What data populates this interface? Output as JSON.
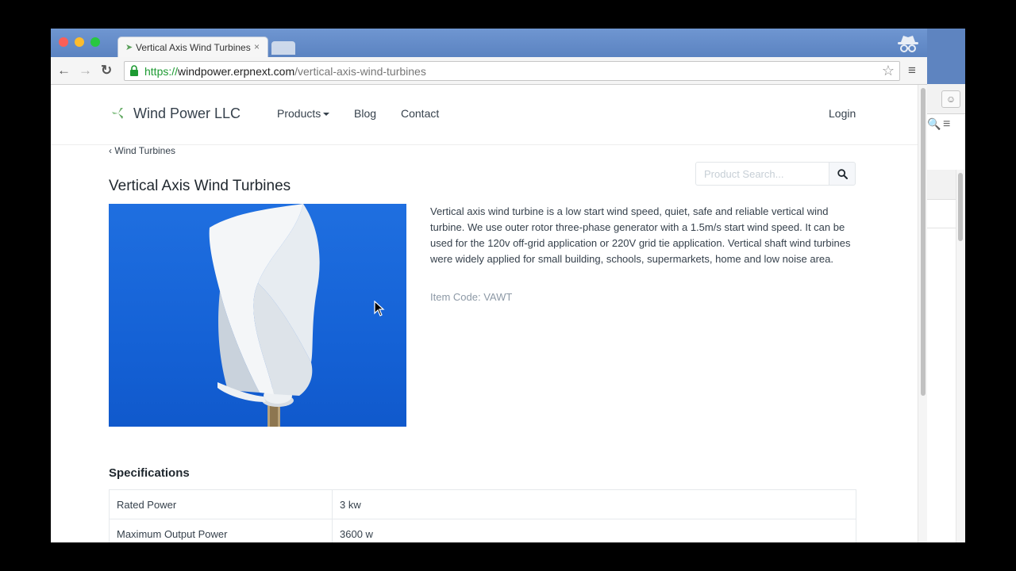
{
  "browser": {
    "tab_title": "Vertical Axis Wind Turbines",
    "tab_close": "×",
    "url_scheme": "https://",
    "url_host": "windpower.erpnext.com",
    "url_path": "/vertical-axis-wind-turbines",
    "back": "←",
    "forward": "→",
    "reload": "↻",
    "star": "☆",
    "menu": "≡",
    "colors": {
      "titlebar": "#5b83c1",
      "secure": "#1d9a32"
    }
  },
  "site": {
    "brand": "Wind Power LLC",
    "nav": {
      "products": "Products",
      "blog": "Blog",
      "contact": "Contact",
      "login": "Login"
    }
  },
  "breadcrumb": "‹ Wind Turbines",
  "search": {
    "placeholder": "Product Search..."
  },
  "product": {
    "title": "Vertical Axis Wind Turbines",
    "description": "Vertical axis wind turbine is a low start wind speed, quiet, safe and reliable vertical wind turbine. We use outer rotor three-phase generator with a 1.5m/s start wind speed. It can be used for the 120v off-grid application or 220V grid tie application. Vertical shaft wind turbines were widely applied for small building, schools, supermarkets, home and low noise area.",
    "item_code": "Item Code: VAWT"
  },
  "specifications": {
    "heading": "Specifications",
    "rows": [
      {
        "label": "Rated Power",
        "value": "3 kw"
      },
      {
        "label": "Maximum Output Power",
        "value": "3600 w"
      }
    ]
  },
  "icons": [
    "wind-turbine-logo-icon",
    "search-icon",
    "lock-icon",
    "star-icon",
    "incognito-icon",
    "hamburger-menu-icon"
  ]
}
